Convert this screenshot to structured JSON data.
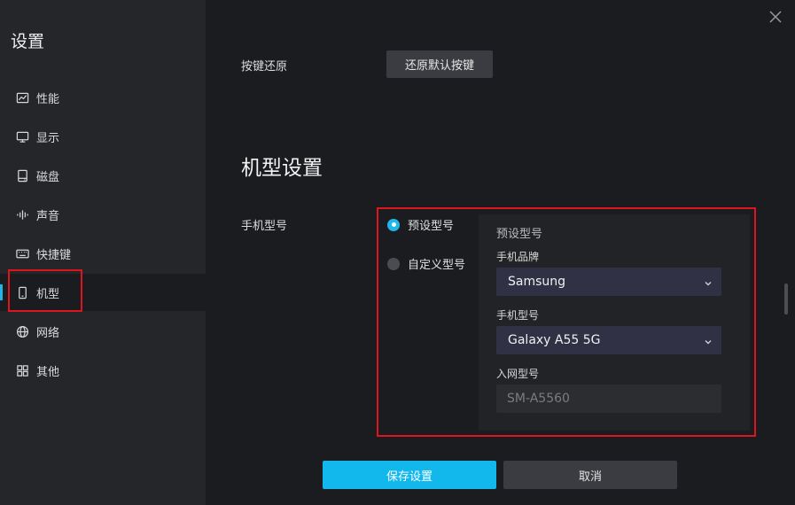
{
  "sidebar": {
    "title": "设置",
    "items": [
      {
        "label": "性能",
        "icon": "chart-icon"
      },
      {
        "label": "显示",
        "icon": "monitor-icon"
      },
      {
        "label": "磁盘",
        "icon": "disk-icon"
      },
      {
        "label": "声音",
        "icon": "sound-icon"
      },
      {
        "label": "快捷键",
        "icon": "keyboard-icon"
      },
      {
        "label": "机型",
        "icon": "phone-icon",
        "active": true
      },
      {
        "label": "网络",
        "icon": "globe-icon"
      },
      {
        "label": "其他",
        "icon": "grid-icon"
      }
    ]
  },
  "keys": {
    "label": "按键还原",
    "button": "还原默认按键"
  },
  "model_section": {
    "title": "机型设置",
    "phone_model_label": "手机型号",
    "radio_preset": "预设型号",
    "radio_custom": "自定义型号",
    "selected_radio": "preset",
    "panel": {
      "title": "预设型号",
      "brand_label": "手机品牌",
      "brand_value": "Samsung",
      "model_label": "手机型号",
      "model_value": "Galaxy A55 5G",
      "network_label": "入网型号",
      "network_value": "SM-A5560"
    }
  },
  "footer": {
    "save": "保存设置",
    "cancel": "取消"
  },
  "colors": {
    "accent": "#1fb6e8",
    "highlight": "#e0141d",
    "background": "#1b1c1f",
    "sidebar": "#25262a"
  }
}
